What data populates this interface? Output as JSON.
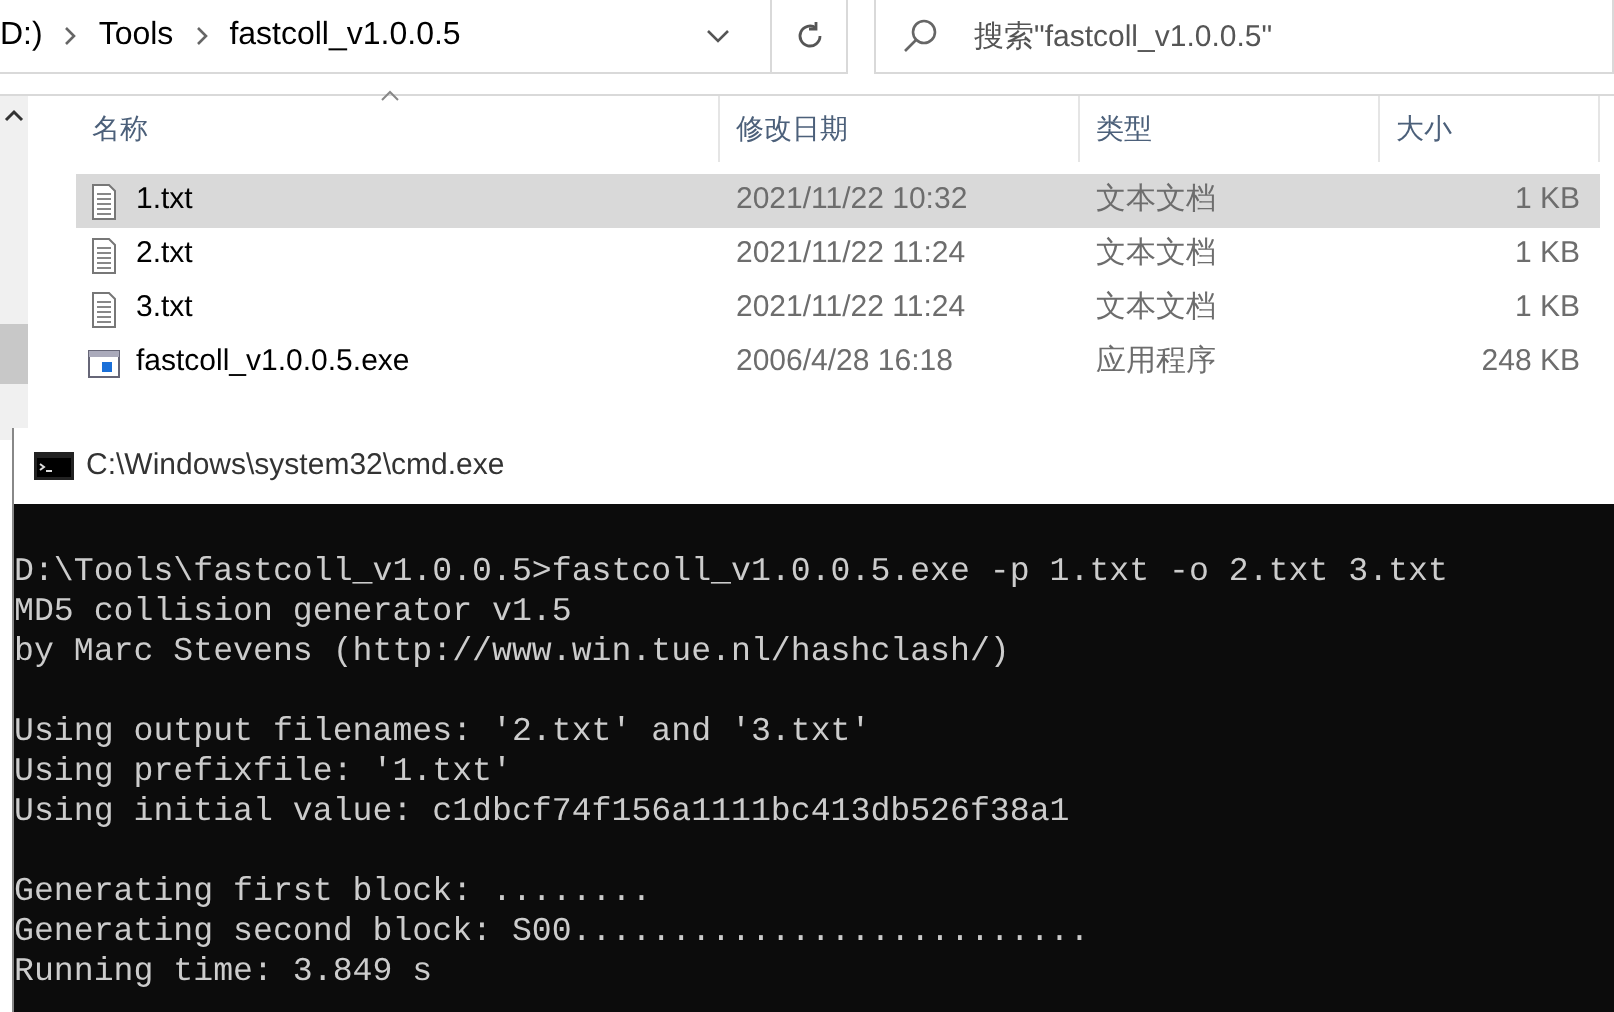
{
  "explorer": {
    "breadcrumb": [
      {
        "label": "D:)"
      },
      {
        "label": "Tools"
      },
      {
        "label": "fastcoll_v1.0.0.5"
      }
    ],
    "search": {
      "placeholder": "搜索\"fastcoll_v1.0.0.5\""
    },
    "columns": [
      "名称",
      "修改日期",
      "类型",
      "大小"
    ],
    "files": [
      {
        "name": "1.txt",
        "modified": "2021/11/22 10:32",
        "type": "文本文档",
        "size": "1 KB",
        "kind": "text",
        "selected": true
      },
      {
        "name": "2.txt",
        "modified": "2021/11/22 11:24",
        "type": "文本文档",
        "size": "1 KB",
        "kind": "text",
        "selected": false
      },
      {
        "name": "3.txt",
        "modified": "2021/11/22 11:24",
        "type": "文本文档",
        "size": "1 KB",
        "kind": "text",
        "selected": false
      },
      {
        "name": "fastcoll_v1.0.0.5.exe",
        "modified": "2006/4/28 16:18",
        "type": "应用程序",
        "size": "248 KB",
        "kind": "exe",
        "selected": false
      }
    ]
  },
  "console": {
    "title": "C:\\Windows\\system32\\cmd.exe",
    "blocks": [
      [
        "D:\\Tools\\fastcoll_v1.0.0.5>fastcoll_v1.0.0.5.exe -p 1.txt -o 2.txt 3.txt",
        "MD5 collision generator v1.5",
        "by Marc Stevens (http://www.win.tue.nl/hashclash/)"
      ],
      [
        "Using output filenames: '2.txt' and '3.txt'",
        "Using prefixfile: '1.txt'",
        "Using initial value: c1dbcf74f156a1111bc413db526f38a1"
      ],
      [
        "Generating first block: ........",
        "Generating second block: S00..........................",
        "Running time: 3.849 s"
      ]
    ]
  }
}
